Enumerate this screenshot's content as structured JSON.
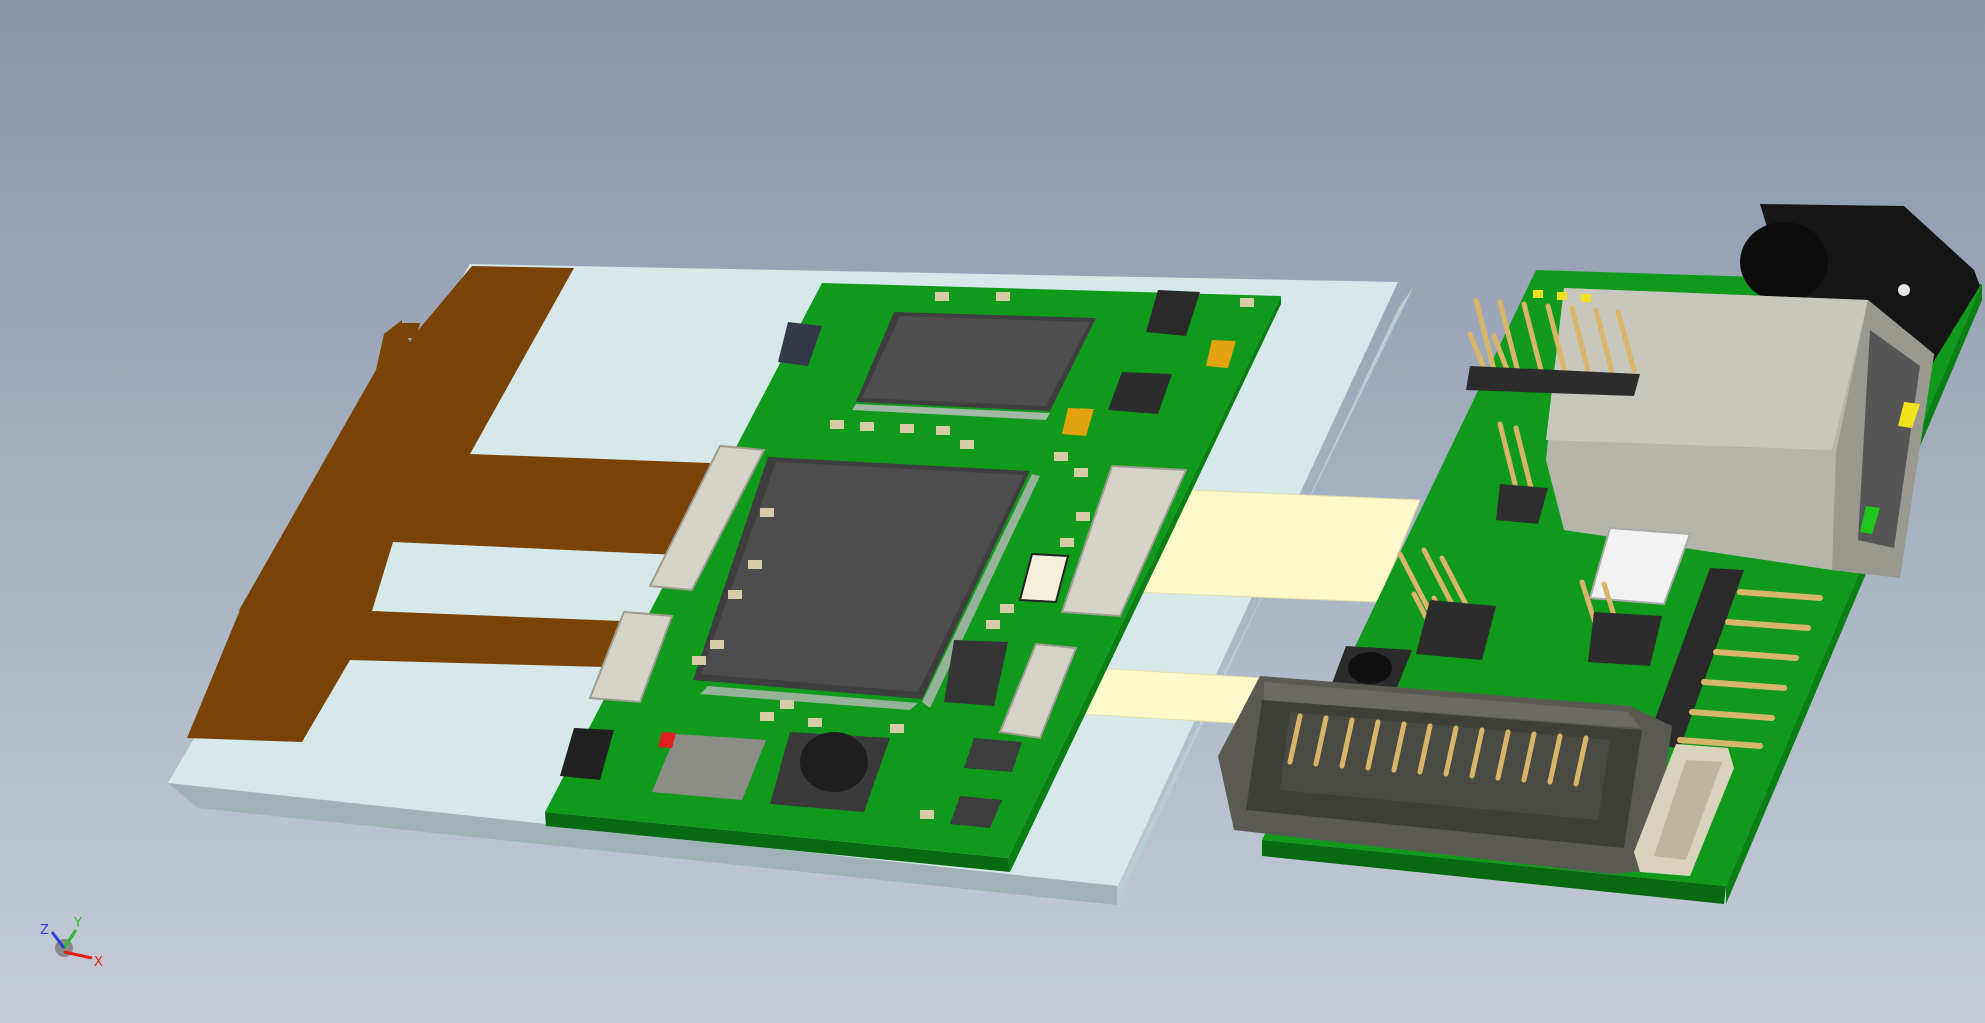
{
  "viewport": {
    "background_top": "#8896aa",
    "background_bottom": "#c5ccd7"
  },
  "scene": {
    "description_icon": "pcb-assembly-3d-model",
    "colors": {
      "pcb_green": "#0f9a1c",
      "pcb_edge": "#076a10",
      "panel_top": "#d6e8ea",
      "panel_side": "#9fb2b6",
      "copper": "#7a4306",
      "ribbon": "#fdf9c8",
      "chip": "#4b4b4b",
      "connector": "#d6d3c8",
      "header_pin": "#d9b56a",
      "jack_black": "#151515",
      "rj45_metal": "#c2c1b7"
    }
  },
  "triad": {
    "z": "Z",
    "y": "Y",
    "x": "X",
    "color_x": "#e0201a",
    "color_y": "#2fb82f",
    "color_z": "#2a3fe0"
  }
}
